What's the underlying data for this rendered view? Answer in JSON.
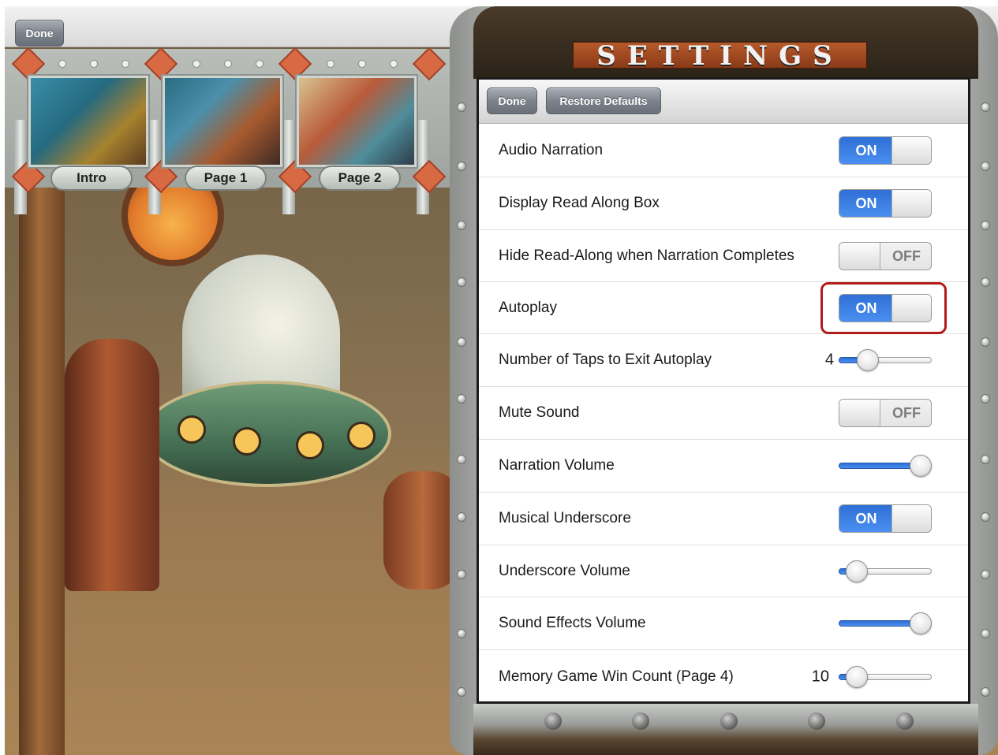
{
  "background": {
    "done_label": "Done",
    "thumbnails": [
      {
        "label": "Intro"
      },
      {
        "label": "Page 1"
      },
      {
        "label": "Page 2"
      }
    ]
  },
  "settings": {
    "title": "SETTINGS",
    "toolbar": {
      "done_label": "Done",
      "restore_label": "Restore Defaults"
    },
    "rows": [
      {
        "label": "Audio Narration",
        "control": "toggle",
        "state": "ON"
      },
      {
        "label": "Display Read Along Box",
        "control": "toggle",
        "state": "ON"
      },
      {
        "label": "Hide Read-Along when Narration Completes",
        "control": "toggle",
        "state": "OFF"
      },
      {
        "label": "Autoplay",
        "control": "toggle",
        "state": "ON"
      },
      {
        "label": "Number of Taps to Exit Autoplay",
        "control": "slider",
        "value_text": "4",
        "level": 0.25
      },
      {
        "label": "Mute Sound",
        "control": "toggle",
        "state": "OFF"
      },
      {
        "label": "Narration Volume",
        "control": "slider",
        "level": 1.0
      },
      {
        "label": "Musical Underscore",
        "control": "toggle",
        "state": "ON"
      },
      {
        "label": "Underscore Volume",
        "control": "slider",
        "level": 0.1
      },
      {
        "label": "Sound Effects Volume",
        "control": "slider",
        "level": 1.0
      },
      {
        "label": "Memory Game Win Count (Page 4)",
        "control": "slider",
        "value_text": "10",
        "level": 0.1
      }
    ]
  },
  "colors": {
    "toggle_on": "#2f6fd6",
    "highlight": "#b31b1b"
  }
}
